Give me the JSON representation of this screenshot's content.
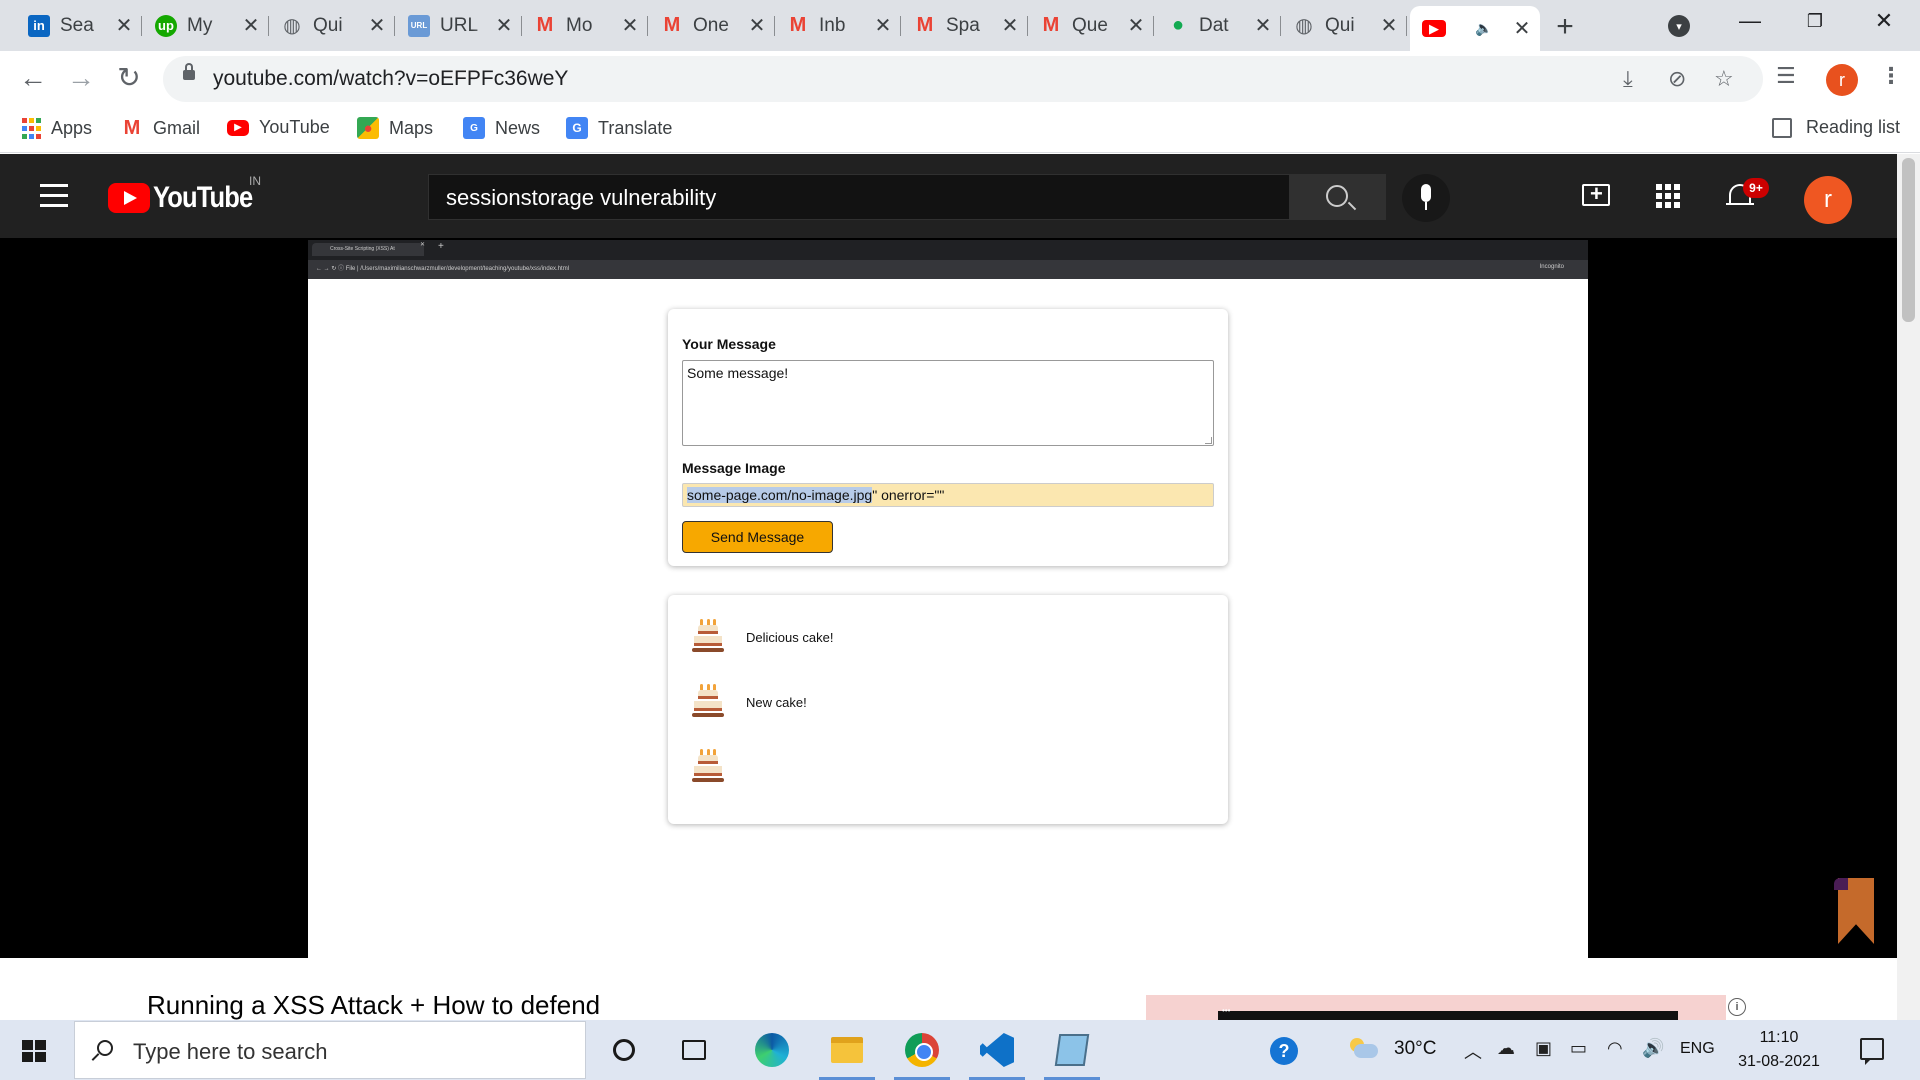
{
  "browser": {
    "tabs": [
      {
        "title": "Sea",
        "icon": "linkedin-icon",
        "color": "#0a66c2",
        "glyph": "in"
      },
      {
        "title": "My",
        "icon": "upwork-icon",
        "color": "#14a800",
        "glyph": "up"
      },
      {
        "title": "Qui",
        "icon": "globe-icon",
        "color": "#5f6368",
        "glyph": "◍"
      },
      {
        "title": "URL",
        "icon": "url-icon",
        "color": "#6a9ad6",
        "glyph": "URL"
      },
      {
        "title": "Mo",
        "icon": "gmail-icon",
        "color": "#ea4335",
        "glyph": "M"
      },
      {
        "title": "One",
        "icon": "gmail-icon",
        "color": "#ea4335",
        "glyph": "M"
      },
      {
        "title": "Inb",
        "icon": "gmail-icon",
        "color": "#ea4335",
        "glyph": "M"
      },
      {
        "title": "Spa",
        "icon": "gmail-icon",
        "color": "#ea4335",
        "glyph": "M"
      },
      {
        "title": "Que",
        "icon": "gmail-icon",
        "color": "#ea4335",
        "glyph": "M"
      },
      {
        "title": "Dat",
        "icon": "mongodb-leaf-icon",
        "color": "#13aa52",
        "glyph": "●"
      },
      {
        "title": "Qui",
        "icon": "globe-icon",
        "color": "#5f6368",
        "glyph": "◍"
      }
    ],
    "active_tab": {
      "icon": "youtube-icon",
      "audio_icon": "speaker-icon",
      "color": "#ff0000"
    },
    "address": "youtube.com/watch?v=oEFPFc36weY",
    "profile_initial": "r",
    "bookmarks": [
      {
        "label": "Apps",
        "icon": "apps-grid-icon"
      },
      {
        "label": "Gmail",
        "icon": "gmail-icon"
      },
      {
        "label": "YouTube",
        "icon": "youtube-icon"
      },
      {
        "label": "Maps",
        "icon": "maps-icon"
      },
      {
        "label": "News",
        "icon": "news-icon"
      },
      {
        "label": "Translate",
        "icon": "translate-icon"
      }
    ],
    "reading_list": "Reading list"
  },
  "youtube": {
    "logo_text": "YouTube",
    "country": "IN",
    "search_query": "sessionstorage vulnerability",
    "notification_badge": "9+",
    "avatar_initial": "r",
    "video_title": "Running a XSS Attack + How to defend"
  },
  "video_content": {
    "inner_tab_title": "Cross-Site Scripting (XSS) At",
    "inner_address_prefix": "File",
    "inner_path": "/Users/maximilianschwarzmuller/development/teaching/youtube/xss/index.html",
    "inner_incognito": "Incognito",
    "message_label": "Your Message",
    "message_value": "Some message!",
    "image_label": "Message Image",
    "image_value_selected": "some-page.com/no-image.jpg",
    "image_value_rest": "\" onerror=\"\"",
    "send_button": "Send Message",
    "messages": [
      {
        "text": "Delicious cake!"
      },
      {
        "text": "New cake!"
      },
      {
        "text": ""
      }
    ]
  },
  "taskbar": {
    "search_placeholder": "Type here to search",
    "temperature": "30°C",
    "language": "ENG",
    "time": "11:10",
    "date": "31-08-2021"
  }
}
